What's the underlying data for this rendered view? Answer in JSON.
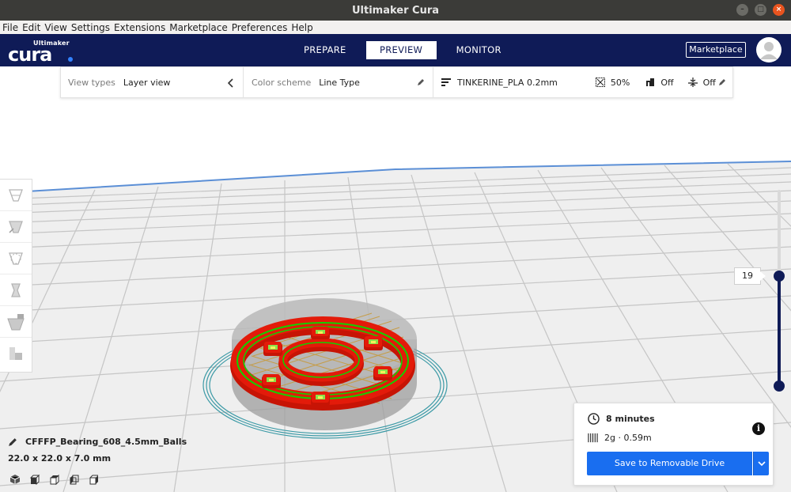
{
  "window": {
    "title": "Ultimaker Cura"
  },
  "menu": [
    "File",
    "Edit",
    "View",
    "Settings",
    "Extensions",
    "Marketplace",
    "Preferences",
    "Help"
  ],
  "brand": {
    "maker": "Ultimaker",
    "product": "cura"
  },
  "nav": {
    "tabs": [
      "PREPARE",
      "PREVIEW",
      "MONITOR"
    ],
    "active": "PREVIEW",
    "marketplace_label": "Marketplace"
  },
  "view_panel": {
    "view_types_label": "View types",
    "view_types_value": "Layer view",
    "color_scheme_label": "Color scheme",
    "color_scheme_value": "Line Type",
    "profile": "TINKERINE_PLA 0.2mm",
    "infill": "50%",
    "support": "Off",
    "adhesion": "Off"
  },
  "toolbar": {
    "tools": [
      "move-tool-icon",
      "scale-tool-icon",
      "rotate-tool-icon",
      "mirror-tool-icon",
      "per-model-settings-icon",
      "support-blocker-icon"
    ]
  },
  "layer_slider": {
    "current_layer": "19",
    "position_fraction": 0.58
  },
  "object": {
    "name": "CFFFP_Bearing_608_4.5mm_Balls",
    "dimensions": "22.0 x 22.0 x 7.0 mm"
  },
  "print_info": {
    "time": "8 minutes",
    "material": "2g · 0.59m",
    "save_label": "Save to Removable Drive"
  },
  "colors": {
    "header": "#0f1b57",
    "accent": "#196ef0",
    "wall": "#e31b0a",
    "inner_wall": "#12d100",
    "infill": "#d6a84a",
    "skirt": "#3c9aa6"
  }
}
